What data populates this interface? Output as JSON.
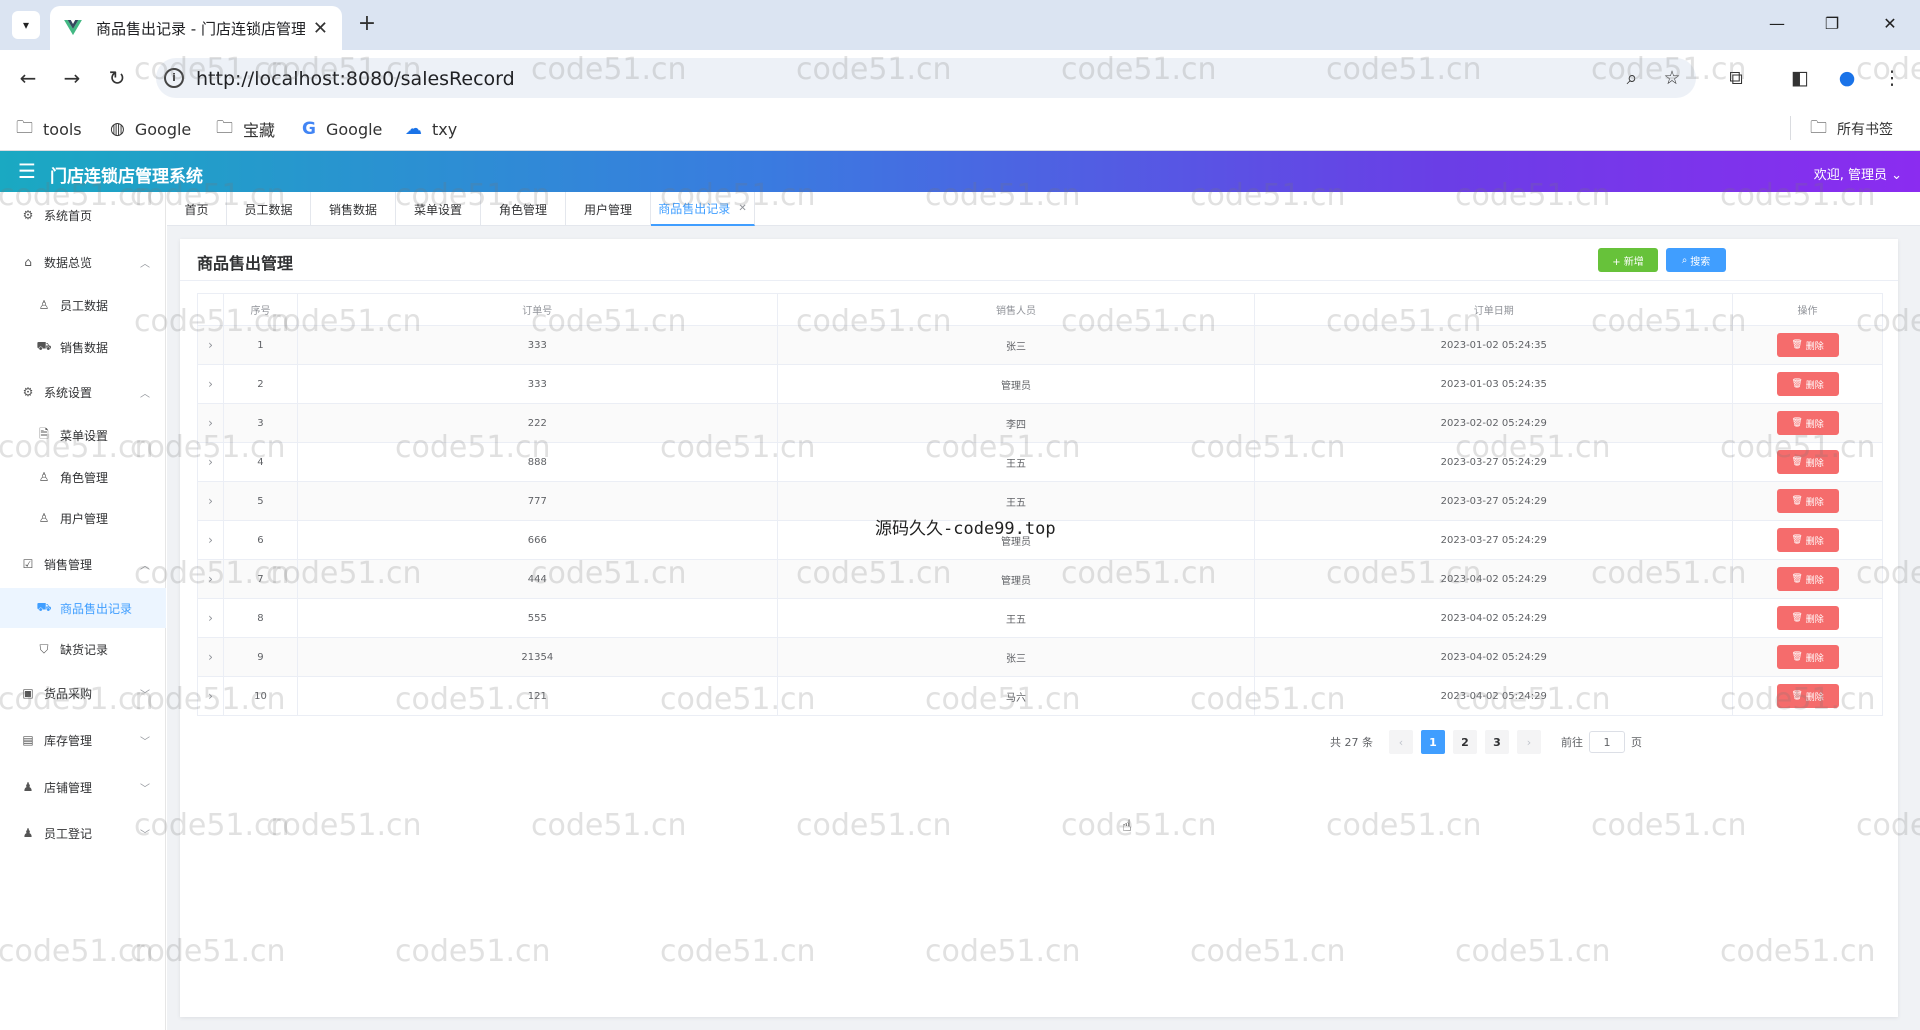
{
  "browser": {
    "tab_title": "商品售出记录 - 门店连锁店管理",
    "url": "http://localhost:8080/salesRecord",
    "bookmarks": [
      {
        "label": "tools",
        "icon": "folder-icon"
      },
      {
        "label": "Google",
        "icon": "globe-icon"
      },
      {
        "label": "宝藏",
        "icon": "folder-icon"
      },
      {
        "label": "Google",
        "icon": "google-icon"
      },
      {
        "label": "txy",
        "icon": "cloud-icon"
      }
    ],
    "all_bookmarks": "所有书签"
  },
  "header": {
    "title": "门店连锁店管理系统",
    "welcome": "欢迎, 管理员"
  },
  "sidebar": {
    "items": [
      {
        "label": "系统首页",
        "icon": "gear-icon",
        "level": 1
      },
      {
        "label": "数据总览",
        "icon": "home-icon",
        "level": 1,
        "arrow": "up"
      },
      {
        "label": "员工数据",
        "icon": "user-icon",
        "level": 2
      },
      {
        "label": "销售数据",
        "icon": "truck-icon",
        "level": 2
      },
      {
        "label": "系统设置",
        "icon": "gear-icon",
        "level": 1,
        "arrow": "up"
      },
      {
        "label": "菜单设置",
        "icon": "document-icon",
        "level": 2
      },
      {
        "label": "角色管理",
        "icon": "user-icon",
        "level": 2
      },
      {
        "label": "用户管理",
        "icon": "user-icon",
        "level": 2
      },
      {
        "label": "销售管理",
        "icon": "checkbox-icon",
        "level": 1,
        "arrow": "up"
      },
      {
        "label": "商品售出记录",
        "icon": "truck-icon",
        "level": 2,
        "active": true
      },
      {
        "label": "缺货记录",
        "icon": "bag-icon",
        "level": 2
      },
      {
        "label": "货品采购",
        "icon": "lock-icon",
        "level": 1,
        "arrow": "down"
      },
      {
        "label": "库存管理",
        "icon": "box-icon",
        "level": 1,
        "arrow": "down"
      },
      {
        "label": "店铺管理",
        "icon": "user-icon",
        "level": 1,
        "arrow": "down"
      },
      {
        "label": "员工登记",
        "icon": "user-icon",
        "level": 1,
        "arrow": "down"
      }
    ]
  },
  "tags": [
    {
      "label": "首页"
    },
    {
      "label": "员工数据"
    },
    {
      "label": "销售数据"
    },
    {
      "label": "菜单设置"
    },
    {
      "label": "角色管理"
    },
    {
      "label": "用户管理"
    },
    {
      "label": "商品售出记录",
      "active": true,
      "closable": true
    }
  ],
  "card": {
    "title": "商品售出管理",
    "add_label": "+ 新增",
    "search_label": "搜索"
  },
  "table": {
    "columns": [
      "序号",
      "订单号",
      "销售人员",
      "订单日期",
      "操作"
    ],
    "delete_label": "删除",
    "rows": [
      {
        "index": "1",
        "order": "333",
        "seller": "张三",
        "date": "2023-01-02 05:24:35"
      },
      {
        "index": "2",
        "order": "333",
        "seller": "管理员",
        "date": "2023-01-03 05:24:35"
      },
      {
        "index": "3",
        "order": "222",
        "seller": "李四",
        "date": "2023-02-02 05:24:29"
      },
      {
        "index": "4",
        "order": "888",
        "seller": "王五",
        "date": "2023-03-27 05:24:29"
      },
      {
        "index": "5",
        "order": "777",
        "seller": "王五",
        "date": "2023-03-27 05:24:29"
      },
      {
        "index": "6",
        "order": "666",
        "seller": "管理员",
        "date": "2023-03-27 05:24:29"
      },
      {
        "index": "7",
        "order": "444",
        "seller": "管理员",
        "date": "2023-04-02 05:24:29"
      },
      {
        "index": "8",
        "order": "555",
        "seller": "王五",
        "date": "2023-04-02 05:24:29"
      },
      {
        "index": "9",
        "order": "21354",
        "seller": "张三",
        "date": "2023-04-02 05:24:29"
      },
      {
        "index": "10",
        "order": "121",
        "seller": "马六",
        "date": "2023-04-02 05:24:29"
      }
    ]
  },
  "pagination": {
    "total": "共 27 条",
    "pages": [
      "1",
      "2",
      "3"
    ],
    "current": "1",
    "goto_label": "前往",
    "goto_value": "1",
    "page_suffix": "页"
  },
  "overlay_text": "源码久久-code99.top",
  "watermark_text": "code51.cn",
  "colors": {
    "primary": "#409eff",
    "success": "#67c23a",
    "danger": "#f56c6c"
  }
}
